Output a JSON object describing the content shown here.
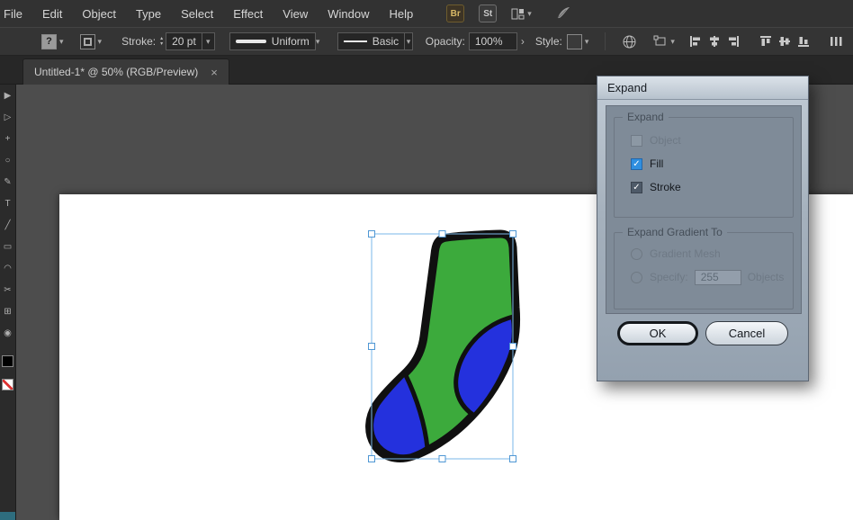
{
  "menu": {
    "items": [
      "File",
      "Edit",
      "Object",
      "Type",
      "Select",
      "Effect",
      "View",
      "Window",
      "Help"
    ]
  },
  "app_bar": {
    "bridge_badge": "Br",
    "stock_badge": "St"
  },
  "control_bar": {
    "unknown_appearance": "?",
    "stroke_label": "Stroke:",
    "stroke_weight_value": "20 pt",
    "width_profile_value": "Uniform",
    "brush_value": "Basic",
    "opacity_label": "Opacity:",
    "opacity_value": "100%",
    "style_label": "Style:"
  },
  "tab": {
    "title": "Untitled-1* @ 50% (RGB/Preview)"
  },
  "dialog": {
    "title": "Expand",
    "group_expand": {
      "label": "Expand",
      "options": [
        {
          "label": "Object",
          "checked": false,
          "disabled": true
        },
        {
          "label": "Fill",
          "checked": true,
          "disabled": false
        },
        {
          "label": "Stroke",
          "checked": true,
          "disabled": false
        }
      ]
    },
    "group_gradient": {
      "label": "Expand Gradient To",
      "radio_mesh": "Gradient Mesh",
      "radio_specify": "Specify:",
      "specify_value": "255",
      "specify_suffix": "Objects"
    },
    "buttons": {
      "ok": "OK",
      "cancel": "Cancel"
    }
  },
  "icons": {
    "chevron_down": "▾",
    "chevron_right": "›",
    "close": "×",
    "check": "✓",
    "step_up": "▴",
    "step_down": "▾"
  },
  "tools": {
    "glyphs": [
      "▶",
      "▷",
      "+",
      "○",
      "✎",
      "T",
      "╱",
      "▭",
      "◠",
      "✂",
      "⊞",
      "◉"
    ]
  },
  "colors": {
    "sock_green": "#3caa3c",
    "sock_blue": "#2431dd",
    "outline_black": "#101010",
    "selection_blue": "#4f97d4",
    "check_blue": "#2f8fe0",
    "canvas_gray": "#4d4d4d",
    "dialog_gray_blue": "#a5b1bd"
  }
}
